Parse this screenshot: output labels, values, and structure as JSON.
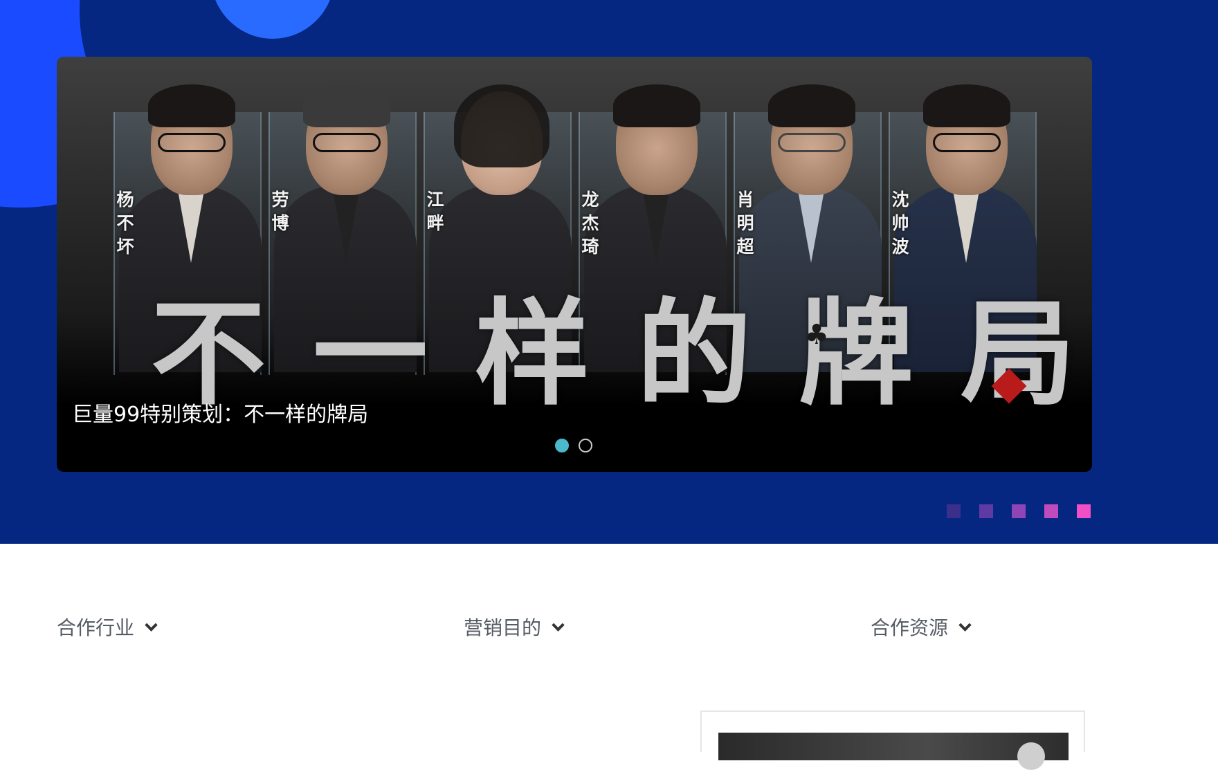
{
  "colors": {
    "hero_background": "#052782",
    "accent_blue": "#1a4bff",
    "dot_active": "#4cb8cc",
    "squares": [
      "#3a2f8a",
      "#5f3aa4",
      "#8f45b5",
      "#c04bbd",
      "#f04fc5"
    ]
  },
  "carousel": {
    "title_characters": [
      "不",
      "一",
      "样",
      "的",
      "牌",
      "局"
    ],
    "hosts": [
      {
        "name": "杨不坏"
      },
      {
        "name": "劳博"
      },
      {
        "name": "江畔"
      },
      {
        "name": "龙杰琦"
      },
      {
        "name": "肖明超"
      },
      {
        "name": "沈帅波"
      }
    ],
    "caption": "巨量99特别策划：不一样的牌局",
    "slide_count": 2,
    "active_slide": 1,
    "card_suit_icon": "club-icon",
    "diamond_icon": "diamond-icon"
  },
  "filters": [
    {
      "label": "合作行业",
      "icon": "chevron-down-icon"
    },
    {
      "label": "营销目的",
      "icon": "chevron-down-icon"
    },
    {
      "label": "合作资源",
      "icon": "chevron-down-icon"
    }
  ]
}
